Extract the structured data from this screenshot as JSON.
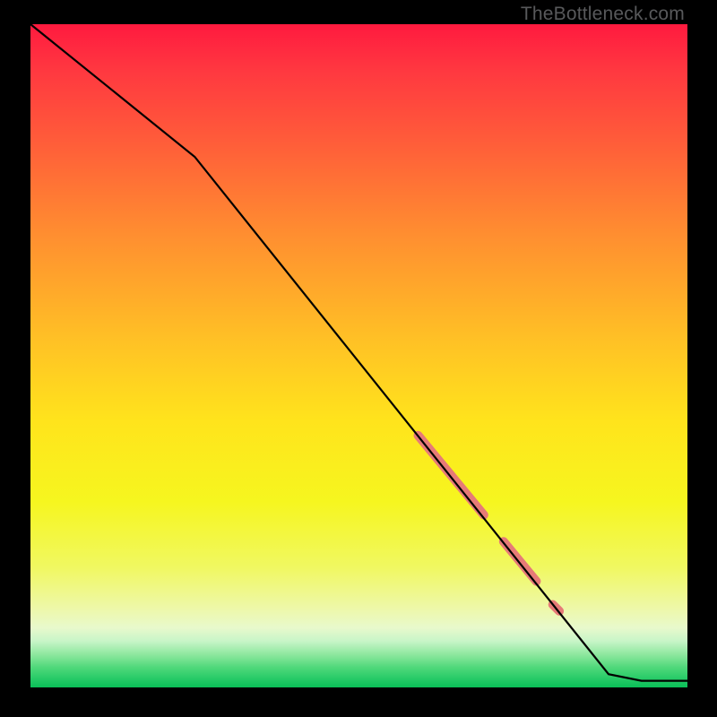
{
  "watermark": "TheBottleneck.com",
  "colors": {
    "line": "#000000",
    "marker": "#e67a77",
    "frame": "#000000"
  },
  "chart_data": {
    "type": "line",
    "title": "",
    "xlabel": "",
    "ylabel": "",
    "xlim": [
      0,
      100
    ],
    "ylim": [
      0,
      100
    ],
    "grid": false,
    "legend": false,
    "series": [
      {
        "name": "curve",
        "x": [
          0,
          25,
          88,
          93,
          100
        ],
        "y": [
          100,
          80,
          2,
          1,
          1
        ]
      }
    ],
    "highlight_segments": [
      {
        "x0": 59,
        "y0": 38,
        "x1": 69,
        "y1": 26,
        "width": 10
      },
      {
        "x0": 72,
        "y0": 22,
        "x1": 77,
        "y1": 16,
        "width": 10
      },
      {
        "x0": 79.5,
        "y0": 12.5,
        "x1": 80.5,
        "y1": 11.5,
        "width": 10
      }
    ]
  }
}
